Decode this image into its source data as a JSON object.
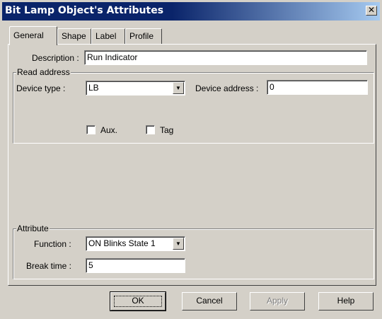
{
  "window": {
    "title": "Bit Lamp Object's Attributes",
    "close_glyph": "✕"
  },
  "tabs": [
    "General",
    "Shape",
    "Label",
    "Profile"
  ],
  "general": {
    "description_label": "Description :",
    "description_value": "Run Indicator",
    "read_address": {
      "legend": "Read address",
      "device_type_label": "Device type :",
      "device_type_value": "LB",
      "device_address_label": "Device address :",
      "device_address_value": "0",
      "aux_label": "Aux.",
      "aux_checked": false,
      "tag_label": "Tag",
      "tag_checked": false
    },
    "attribute": {
      "legend": "Attribute",
      "function_label": "Function :",
      "function_value": "ON Blinks State 1",
      "break_time_label": "Break time :",
      "break_time_value": "5"
    }
  },
  "buttons": {
    "ok": "OK",
    "cancel": "Cancel",
    "apply": "Apply",
    "help": "Help"
  }
}
